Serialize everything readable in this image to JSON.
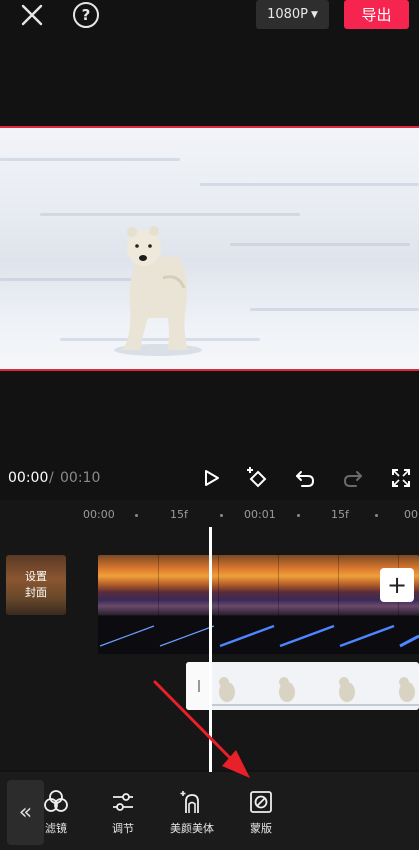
{
  "topbar": {
    "close_icon": "close-icon",
    "help_icon": "help-icon",
    "resolution_label": "1080P",
    "export_label": "导出"
  },
  "playback": {
    "current_time": "00:00",
    "separator": "/",
    "total_time": "00:10"
  },
  "timeline": {
    "ruler": [
      "00:00",
      "15f",
      "00:01",
      "15f",
      "00"
    ],
    "cover_label": "设置封面",
    "add_label": "+"
  },
  "toolbar": {
    "tools": [
      {
        "label": "滤镜",
        "icon": "filter-icon"
      },
      {
        "label": "调节",
        "icon": "adjust-icon"
      },
      {
        "label": "美颜美体",
        "icon": "beauty-icon"
      },
      {
        "label": "蒙版",
        "icon": "mask-icon"
      }
    ]
  },
  "colors": {
    "accent": "#f5254f",
    "annotation_arrow": "#e8202a"
  }
}
